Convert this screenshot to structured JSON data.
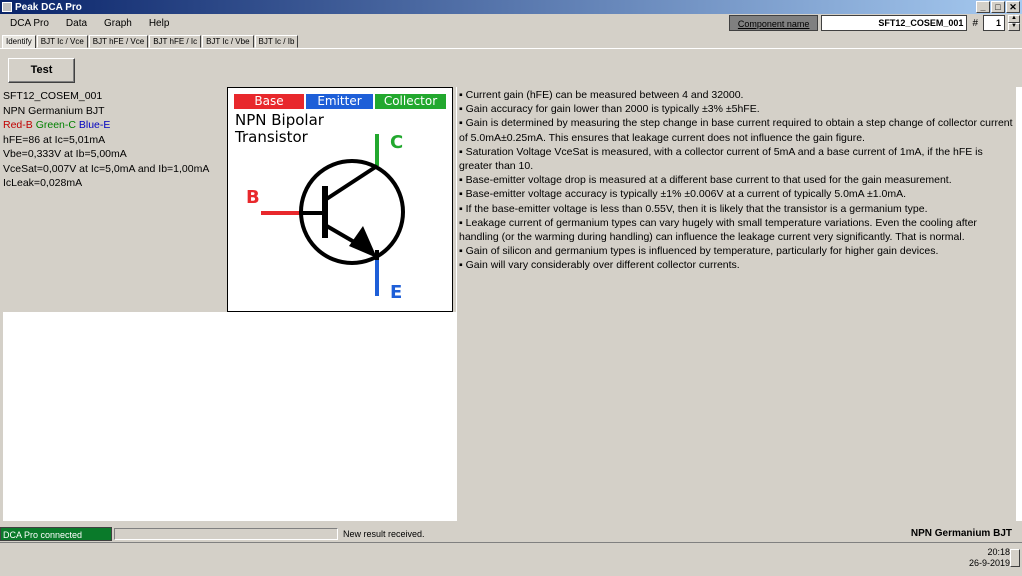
{
  "window": {
    "title": "Peak DCA Pro",
    "controls": [
      "_",
      "□",
      "✕"
    ]
  },
  "menu": [
    "DCA Pro",
    "Data",
    "Graph",
    "Help"
  ],
  "component": {
    "label": "Component name",
    "value": "SFT12_COSEM_001",
    "hash": "#",
    "number": "1"
  },
  "tabs": [
    "Identify",
    "BJT Ic / Vce",
    "BJT hFE / Vce",
    "BJT hFE / Ic",
    "BJT Ic / Vbe",
    "BJT Ic / Ib"
  ],
  "test_button": "Test",
  "results": {
    "name": "SFT12_COSEM_001",
    "type": "NPN Germanium BJT",
    "pins": {
      "b": "Red-B",
      "c": "Green-C",
      "e": "Blue-E"
    },
    "hfe": "hFE=86 at Ic=5,01mA",
    "vbe": "Vbe=0,333V at Ib=5,00mA",
    "vcesat": "VceSat=0,007V at Ic=5,0mA and Ib=1,00mA",
    "icleak": "IcLeak=0,028mA"
  },
  "diagram": {
    "legend": {
      "base": "Base",
      "emitter": "Emitter",
      "collector": "Collector"
    },
    "title_line1": "NPN Bipolar",
    "title_line2": "Transistor",
    "pin_c": "C",
    "pin_b": "B",
    "pin_e": "E",
    "colors": {
      "base": "#e8282c",
      "emitter": "#1e5fd8",
      "collector": "#22a82e"
    }
  },
  "notes": [
    "▪ Current gain (hFE) can be measured between 4 and 32000.",
    "▪ Gain accuracy for gain lower than 2000 is typically ±3% ±5hFE.",
    "▪ Gain is determined by measuring the step change in base current required to obtain a step change of collector current of 5.0mA±0.25mA. This ensures that leakage current does not influence the gain figure.",
    "▪ Saturation Voltage VceSat is measured, with a collector current of 5mA and a base current of 1mA, if the hFE is greater than 10.",
    "▪ Base-emitter voltage drop is measured at a different base current to that used for the gain measurement.",
    "▪ Base-emitter voltage accuracy is typically ±1% ±0.006V at a current of typically 5.0mA ±1.0mA.",
    "▪ If the base-emitter voltage is less than 0.55V, then it is likely that the transistor is a germanium type.",
    "▪ Leakage current of germanium types can vary hugely with small temperature variations. Even the cooling after handling (or the warming during handling) can influence the leakage current very significantly. That is normal.",
    "▪ Gain of silicon and germanium types is influenced by temperature, particularly for higher gain devices.",
    "▪ Gain will vary considerably over different collector currents."
  ],
  "status": {
    "connection": "DCA Pro connected",
    "message": "New result received.",
    "component_type": "NPN Germanium BJT"
  },
  "clock": {
    "time": "20:18",
    "date": "26-9-2019"
  }
}
